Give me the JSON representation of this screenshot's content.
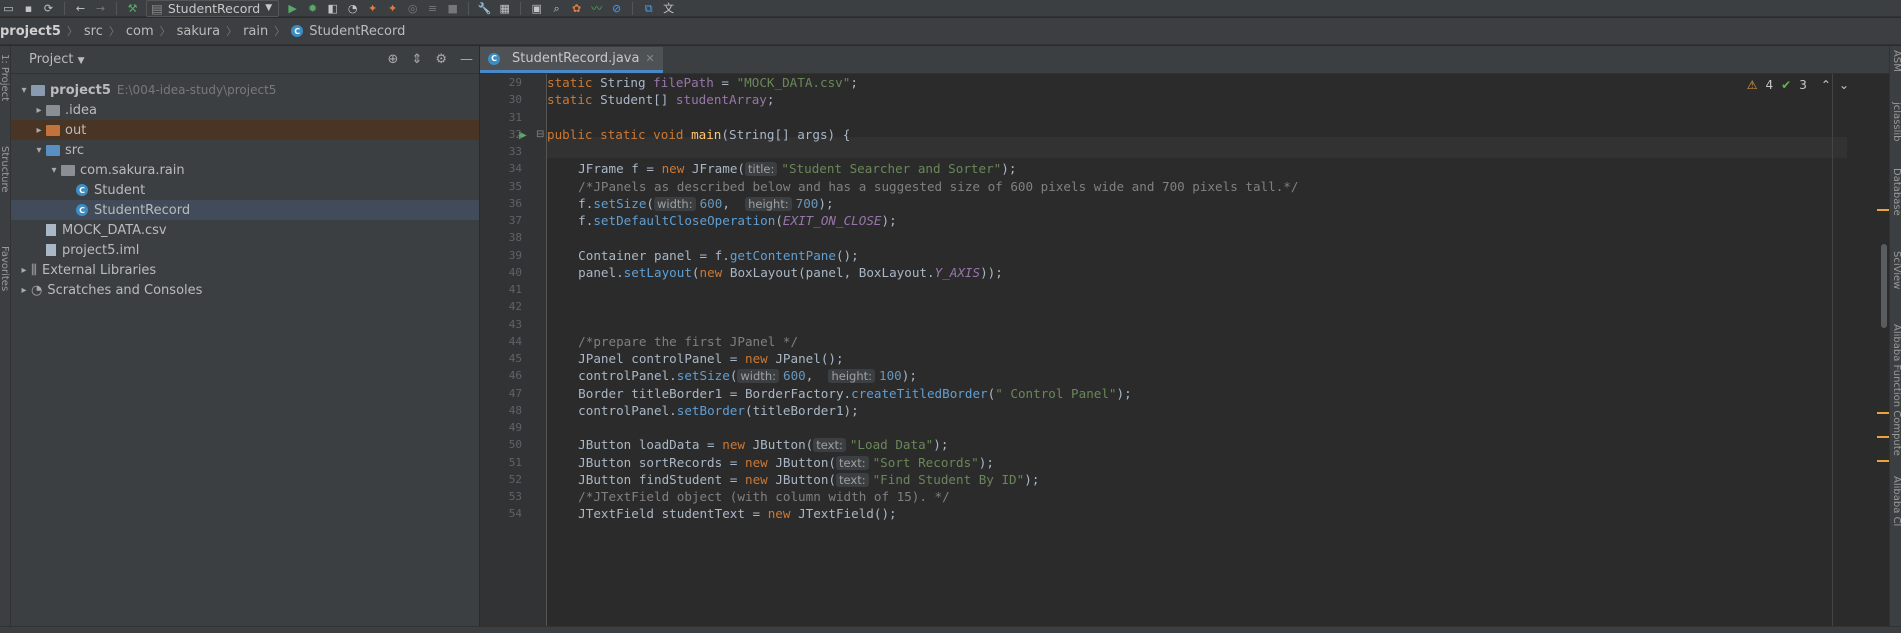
{
  "toolbar": {
    "run_config": "StudentRecord"
  },
  "breadcrumb": [
    {
      "label": "project5",
      "bold": true
    },
    {
      "label": "src"
    },
    {
      "label": "com"
    },
    {
      "label": "sakura"
    },
    {
      "label": "rain"
    },
    {
      "label": "StudentRecord"
    }
  ],
  "left_strip": {
    "labels": [
      "1: Project",
      "Structure",
      "Favorites"
    ]
  },
  "project_panel": {
    "title": "Project",
    "tree": [
      {
        "label": "project5",
        "hint": "E:\\004-idea-study\\project5",
        "indent": 0,
        "arrow": "▾",
        "icon": "folder-module",
        "bold": true
      },
      {
        "label": ".idea",
        "indent": 1,
        "arrow": "▸",
        "icon": "folder-gray"
      },
      {
        "label": "out",
        "indent": 1,
        "arrow": "▸",
        "icon": "folder-orange",
        "state": "excluded"
      },
      {
        "label": "src",
        "indent": 1,
        "arrow": "▾",
        "icon": "folder-blue"
      },
      {
        "label": "com.sakura.rain",
        "indent": 2,
        "arrow": "▾",
        "icon": "package"
      },
      {
        "label": "Student",
        "indent": 3,
        "arrow": "",
        "icon": "class"
      },
      {
        "label": "StudentRecord",
        "indent": 3,
        "arrow": "",
        "icon": "class",
        "state": "selected"
      },
      {
        "label": "MOCK_DATA.csv",
        "indent": 1,
        "arrow": "",
        "icon": "file"
      },
      {
        "label": "project5.iml",
        "indent": 1,
        "arrow": "",
        "icon": "file"
      },
      {
        "label": "External Libraries",
        "indent": 0,
        "arrow": "▸",
        "icon": "library"
      },
      {
        "label": "Scratches and Consoles",
        "indent": 0,
        "arrow": "▸",
        "icon": "scratch"
      }
    ]
  },
  "editor": {
    "tab_label": "StudentRecord.java",
    "inspections": {
      "warnings": "4",
      "weak": "3"
    },
    "line_numbers": [
      "29",
      "30",
      "31",
      "32",
      "33",
      "34",
      "35",
      "36",
      "37",
      "38",
      "39",
      "40",
      "41",
      "42",
      "43",
      "44",
      "45",
      "46",
      "47",
      "48",
      "49",
      "50",
      "51",
      "52",
      "53",
      "54"
    ],
    "code": [
      [
        [
          "kw",
          "static "
        ],
        [
          "cls",
          "String "
        ],
        [
          "fld",
          "filePath"
        ],
        [
          "cls",
          " = "
        ],
        [
          "str",
          "\"MOCK_DATA.csv\""
        ],
        [
          "cls",
          ";"
        ]
      ],
      [
        [
          "kw",
          "static "
        ],
        [
          "cls",
          "Student[] "
        ],
        [
          "fld",
          "studentArray"
        ],
        [
          "cls",
          ";"
        ]
      ],
      [],
      [
        [
          "kw",
          "public static void "
        ],
        [
          "mth",
          "main"
        ],
        [
          "cls",
          "(String[] args) {"
        ]
      ],
      [],
      [
        [
          "cls",
          "  JFrame f = "
        ],
        [
          "kw",
          "new "
        ],
        [
          "cls",
          "JFrame("
        ],
        [
          "hint",
          "title:"
        ],
        [
          "str",
          "\"Student Searcher and Sorter\""
        ],
        [
          "cls",
          ");"
        ]
      ],
      [
        [
          "cmt",
          "  /*JPanels as described below and has a suggested size of 600 pixels wide and 700 pixels tall.*/"
        ]
      ],
      [
        [
          "cls",
          "  f."
        ],
        [
          "call",
          "setSize"
        ],
        [
          "cls",
          "("
        ],
        [
          "hint",
          "width:"
        ],
        [
          "num",
          "600"
        ],
        [
          "cls",
          ",  "
        ],
        [
          "hint",
          "height:"
        ],
        [
          "num",
          "700"
        ],
        [
          "cls",
          ");"
        ]
      ],
      [
        [
          "cls",
          "  f."
        ],
        [
          "call",
          "setDefaultCloseOperation"
        ],
        [
          "cls",
          "("
        ],
        [
          "static-fld",
          "EXIT_ON_CLOSE"
        ],
        [
          "cls",
          ");"
        ]
      ],
      [],
      [
        [
          "cls",
          "  Container panel = f."
        ],
        [
          "call",
          "getContentPane"
        ],
        [
          "cls",
          "();"
        ]
      ],
      [
        [
          "cls",
          "  panel."
        ],
        [
          "call",
          "setLayout"
        ],
        [
          "cls",
          "("
        ],
        [
          "kw",
          "new "
        ],
        [
          "cls",
          "BoxLayout(panel, BoxLayout."
        ],
        [
          "static-fld",
          "Y_AXIS"
        ],
        [
          "cls",
          "));"
        ]
      ],
      [],
      [],
      [],
      [
        [
          "cmt",
          "  /*prepare the first JPanel */"
        ]
      ],
      [
        [
          "cls",
          "  JPanel controlPanel = "
        ],
        [
          "kw",
          "new "
        ],
        [
          "cls",
          "JPanel();"
        ]
      ],
      [
        [
          "cls",
          "  controlPanel."
        ],
        [
          "call",
          "setSize"
        ],
        [
          "cls",
          "("
        ],
        [
          "hint",
          "width:"
        ],
        [
          "num",
          "600"
        ],
        [
          "cls",
          ",  "
        ],
        [
          "hint",
          "height:"
        ],
        [
          "num",
          "100"
        ],
        [
          "cls",
          ");"
        ]
      ],
      [
        [
          "cls",
          "  Border titleBorder1 = BorderFactory."
        ],
        [
          "call",
          "createTitledBorder"
        ],
        [
          "cls",
          "("
        ],
        [
          "str",
          "\" Control Panel\""
        ],
        [
          "cls",
          ");"
        ]
      ],
      [
        [
          "cls",
          "  controlPanel."
        ],
        [
          "call",
          "setBorder"
        ],
        [
          "cls",
          "(titleBorder1);"
        ]
      ],
      [],
      [
        [
          "cls",
          "  JButton loadData = "
        ],
        [
          "kw",
          "new "
        ],
        [
          "cls",
          "JButton("
        ],
        [
          "hint",
          "text:"
        ],
        [
          "str",
          "\"Load Data\""
        ],
        [
          "cls",
          ");"
        ]
      ],
      [
        [
          "cls",
          "  JButton sortRecords = "
        ],
        [
          "kw",
          "new "
        ],
        [
          "cls",
          "JButton("
        ],
        [
          "hint",
          "text:"
        ],
        [
          "str",
          "\"Sort Records\""
        ],
        [
          "cls",
          ");"
        ]
      ],
      [
        [
          "cls",
          "  JButton findStudent = "
        ],
        [
          "kw",
          "new "
        ],
        [
          "cls",
          "JButton("
        ],
        [
          "hint",
          "text:"
        ],
        [
          "str",
          "\"Find Student By ID\""
        ],
        [
          "cls",
          ");"
        ]
      ],
      [
        [
          "cmt",
          "  /*JTextField object (with column width of 15). */"
        ]
      ],
      [
        [
          "cls",
          "  JTextField studentText = "
        ],
        [
          "kw",
          "new "
        ],
        [
          "cls",
          "JTextField();"
        ]
      ]
    ]
  },
  "right_strip": {
    "labels": [
      "ASM",
      "jclasslib",
      "Database",
      "SciView",
      "Alibaba Function Compute",
      "Alibaba Cl"
    ]
  }
}
